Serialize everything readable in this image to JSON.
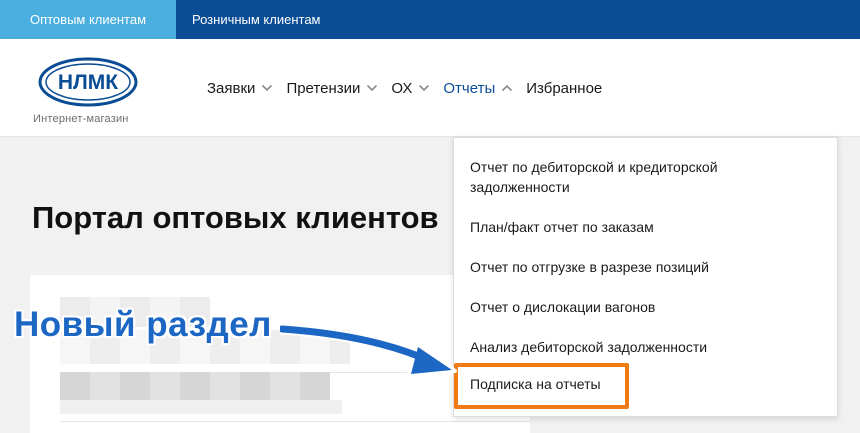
{
  "topbar": {
    "tabs": [
      {
        "label": "Оптовым клиентам",
        "active": true
      },
      {
        "label": "Розничным клиентам",
        "active": false
      }
    ]
  },
  "header": {
    "logo_text": "НЛМК",
    "logo_caption": "Интернет-магазин",
    "nav": [
      {
        "label": "Заявки",
        "icon": "chevron-down-icon"
      },
      {
        "label": "Претензии",
        "icon": "chevron-down-icon"
      },
      {
        "label": "ОХ",
        "icon": "chevron-down-icon"
      },
      {
        "label": "Отчеты",
        "icon": "chevron-up-icon",
        "active": true
      },
      {
        "label": "Избранное"
      }
    ]
  },
  "main": {
    "title": "Портал оптовых клиентов"
  },
  "reports_menu": {
    "items": [
      "Отчет по дебиторской и кредиторской задолженности",
      "План/факт отчет по заказам",
      "Отчет по отгрузке в разрезе позиций",
      "Отчет о дислокации вагонов",
      "Анализ дебиторской задолженности",
      "Подписка на отчеты"
    ],
    "highlighted_index": 5
  },
  "annotation": {
    "label": "Новый раздел"
  },
  "colors": {
    "topbar": "#0a4d95",
    "active_tab": "#4aafdf",
    "accent": "#0a4d95",
    "highlight": "#f07b13",
    "annotation": "#1d67c4"
  }
}
